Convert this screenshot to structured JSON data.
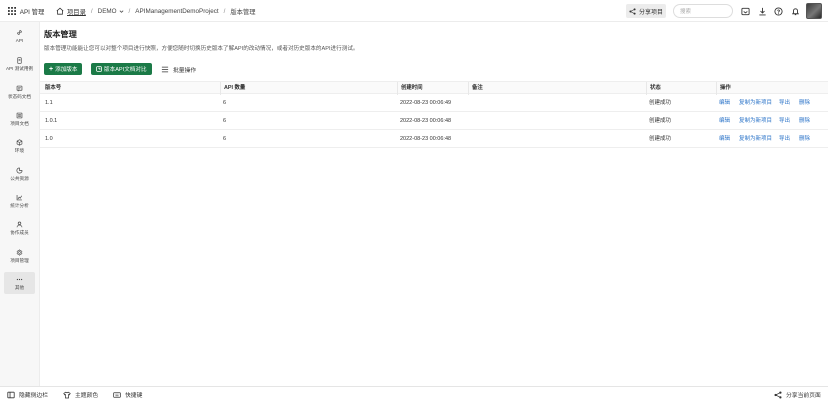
{
  "header": {
    "brand": "API 管理",
    "breadcrumb": {
      "home": "项目录",
      "team": "DEMO",
      "project": "APIManagementDemoProject",
      "page": "版本管理"
    },
    "share_button": "分享项目",
    "search_placeholder": "搜索"
  },
  "sidebar": {
    "items": [
      {
        "label": "API",
        "icon": "link-icon"
      },
      {
        "label": "API 测试用例",
        "icon": "document-icon"
      },
      {
        "label": "状态码文档",
        "icon": "status-code-icon"
      },
      {
        "label": "项目文档",
        "icon": "docs-icon"
      },
      {
        "label": "环境",
        "icon": "cube-icon"
      },
      {
        "label": "公共资源",
        "icon": "resource-icon"
      },
      {
        "label": "统计分析",
        "icon": "chart-icon"
      },
      {
        "label": "协作成员",
        "icon": "user-icon"
      },
      {
        "label": "项目管理",
        "icon": "gear-icon"
      },
      {
        "label": "其他",
        "icon": "more-icon"
      }
    ]
  },
  "main": {
    "title": "版本管理",
    "description": "版本管理功能能让您可以对整个项目进行快照，方便您随时切换历史版本了解API的改动情况，或者对历史版本的API进行测试。",
    "buttons": {
      "add_version": "添加版本",
      "compare_docs": "版本API文档对比",
      "batch_ops": "批量操作"
    },
    "table": {
      "headers": [
        "版本号",
        "API 数量",
        "创建时间",
        "备注",
        "状态",
        "操作"
      ],
      "rows": [
        {
          "version": "1.1",
          "api_count": "6",
          "created": "2022-08-23 00:06:49",
          "note": "",
          "status": "创建成功"
        },
        {
          "version": "1.0.1",
          "api_count": "6",
          "created": "2022-08-23 00:06:48",
          "note": "",
          "status": "创建成功"
        },
        {
          "version": "1.0",
          "api_count": "6",
          "created": "2022-08-23 00:06:48",
          "note": "",
          "status": "创建成功"
        }
      ],
      "actions": [
        "编辑",
        "复制为新项目",
        "导出",
        "删除"
      ]
    }
  },
  "footer": {
    "hide_sidebar": "隐藏侧边栏",
    "theme_color": "主题颜色",
    "shortcuts": "快捷键",
    "share_page": "分享当前页面"
  },
  "colors": {
    "primary": "#1b7a47",
    "link": "#2a73c8"
  }
}
